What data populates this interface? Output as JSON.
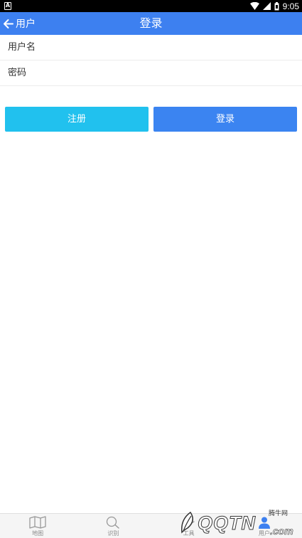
{
  "status_bar": {
    "time": "9:05"
  },
  "header": {
    "back_label": "用户",
    "title": "登录"
  },
  "form": {
    "username_placeholder": "用户名",
    "password_placeholder": "密码",
    "register_label": "注册",
    "login_label": "登录"
  },
  "bottom_nav": {
    "items": [
      {
        "label": "地图",
        "icon": "map-icon"
      },
      {
        "label": "识别",
        "icon": "search-icon"
      },
      {
        "label": "工具",
        "icon": "tools-icon"
      },
      {
        "label": "用户",
        "icon": "user-icon"
      }
    ]
  },
  "watermark": {
    "brand": "QQTN",
    "small_text": "腾牛网",
    "domain_suffix": ".com"
  },
  "colors": {
    "app_bar": "#3d80f0",
    "register_button": "#21c1ee",
    "login_button": "#3b84f1"
  }
}
